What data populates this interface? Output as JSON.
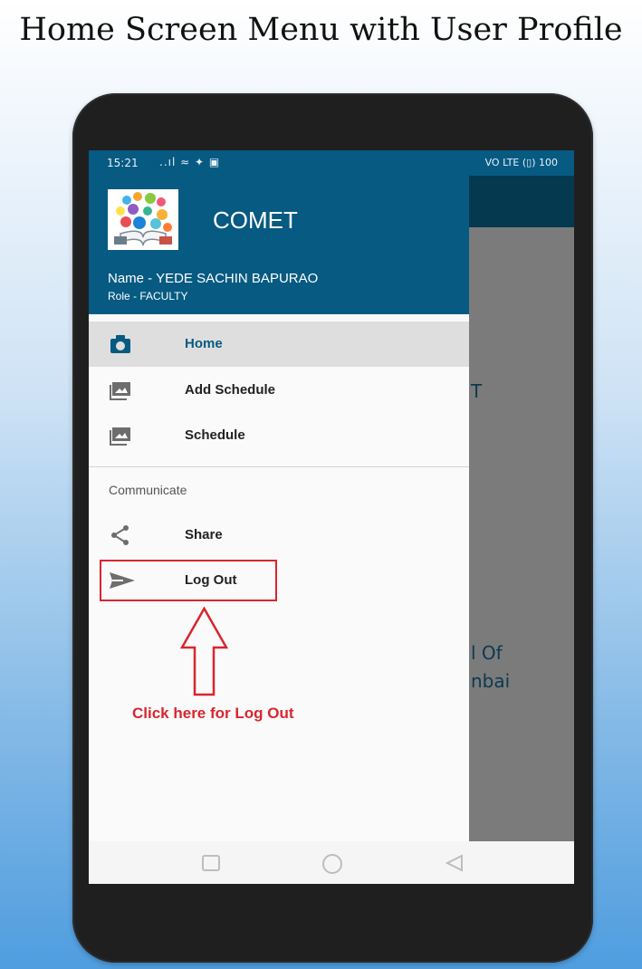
{
  "page_title": "Home Screen Menu with User Profile",
  "status_bar": {
    "time": "15:21",
    "left_icons": "..ıl ≈ ✦ ▣",
    "right_text": "VO LTE (▯) 100"
  },
  "background_app": {
    "text_1": "T",
    "text_2": "l Of",
    "text_3": "nbai"
  },
  "drawer": {
    "app_name": "COMET",
    "user_name": "Name - YEDE SACHIN BAPURAO",
    "user_role": "Role - FACULTY",
    "menu": [
      {
        "label": "Home",
        "icon": "camera-icon",
        "active": true
      },
      {
        "label": "Add Schedule",
        "icon": "image-icon",
        "active": false
      },
      {
        "label": "Schedule",
        "icon": "image-icon",
        "active": false
      }
    ],
    "section_title": "Communicate",
    "communicate_items": [
      {
        "label": "Share",
        "icon": "share-icon"
      },
      {
        "label": "Log Out",
        "icon": "send-icon"
      }
    ]
  },
  "annotation": {
    "hint": "Click here for Log Out",
    "color": "#d8262d"
  },
  "colors": {
    "primary": "#075a82",
    "primary_dark": "#05394f",
    "active_item_bg": "#dedede"
  },
  "nav_icons": [
    "recent-apps-icon",
    "home-circle-icon",
    "back-triangle-icon"
  ]
}
